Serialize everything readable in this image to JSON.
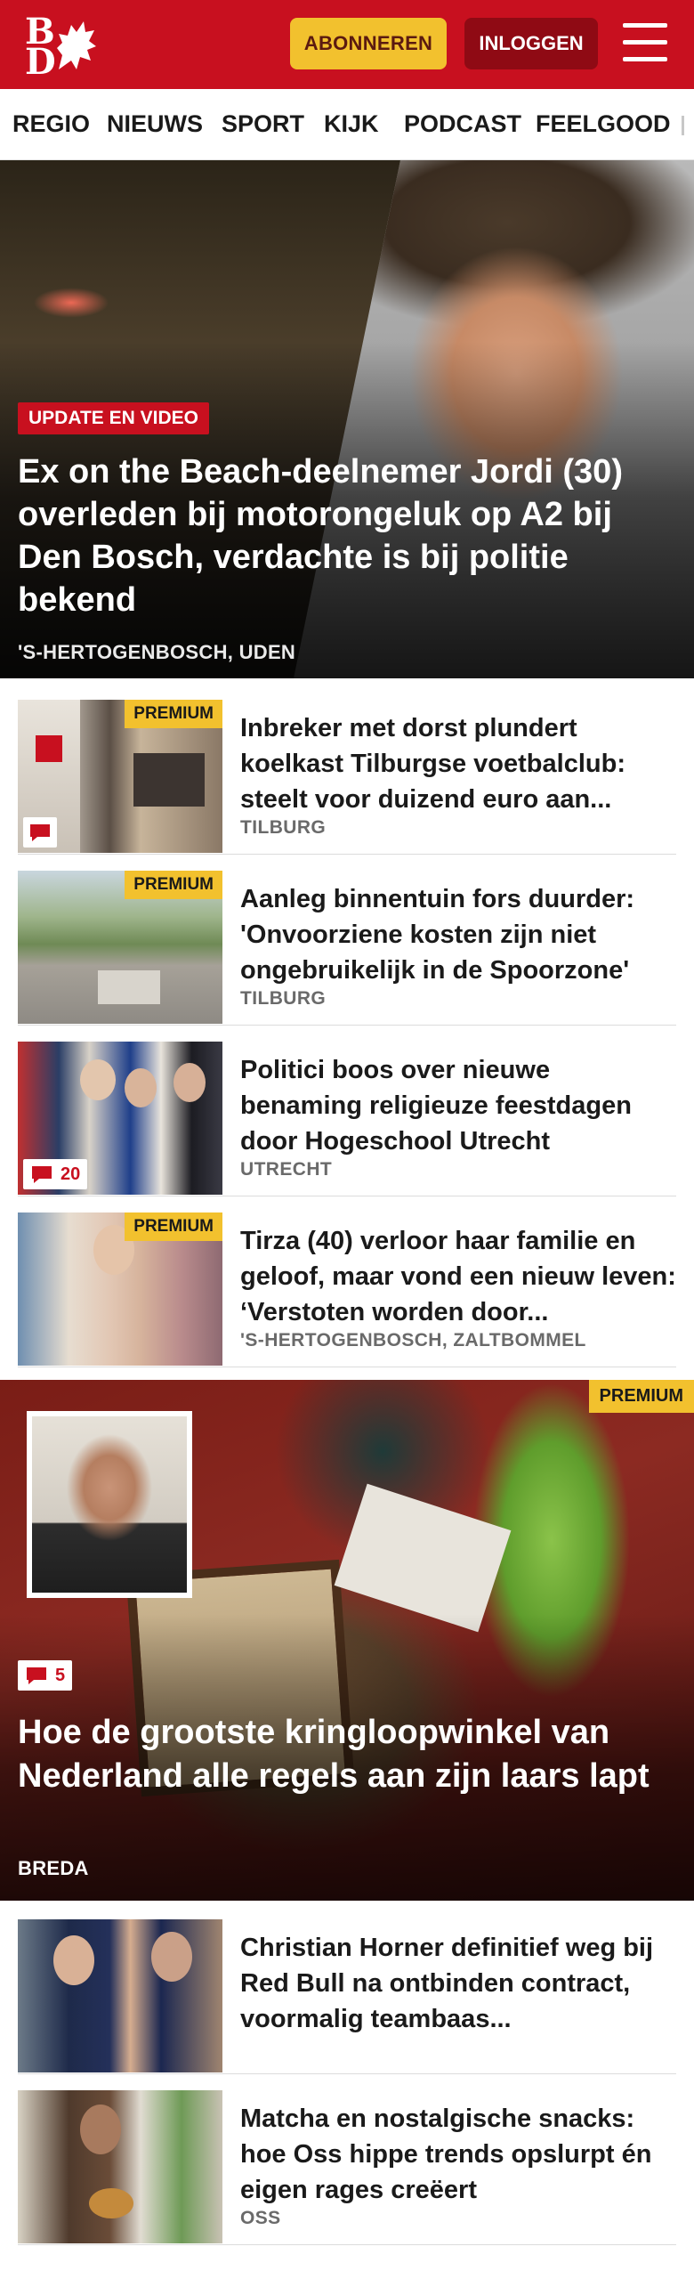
{
  "header": {
    "logo_letters": [
      "B",
      "D"
    ],
    "subscribe_label": "ABONNEREN",
    "login_label": "INLOGGEN",
    "brand_color": "#c8101f",
    "accent_color": "#f2c12e"
  },
  "nav": {
    "items": [
      "REGIO",
      "NIEUWS",
      "SPORT",
      "KIJK",
      "PODCAST",
      "FEELGOOD"
    ]
  },
  "hero": {
    "label": "UPDATE EN VIDEO",
    "title": "Ex on the Beach-deelnemer Jordi (30) overleden bij motorongeluk op A2 bij Den Bosch, verdachte is bij politie bekend",
    "location": "'S-HERTOGENBOSCH, UDEN"
  },
  "articles": [
    {
      "premium": "PREMIUM",
      "comments": "",
      "title": "Inbreker met dorst plundert koelkast Tilburgse voetbalclub: steelt voor duizend euro aan...",
      "location": "TILBURG"
    },
    {
      "premium": "PREMIUM",
      "comments": "",
      "title": "Aanleg binnentuin fors duurder: 'Onvoorziene kosten zijn niet ongebruikelijk in de Spoorzone'",
      "location": "TILBURG"
    },
    {
      "premium": "",
      "comments": "20",
      "title": "Politici boos over nieuwe benaming religieuze feestdagen door Hogeschool Utrecht",
      "location": "UTRECHT"
    },
    {
      "premium": "PREMIUM",
      "comments": "",
      "title": "Tirza (40) verloor haar familie en geloof, maar vond een nieuw leven: ‘Verstoten worden door...",
      "location": "'S-HERTOGENBOSCH, ZALTBOMMEL"
    }
  ],
  "feature": {
    "premium": "PREMIUM",
    "comments": "5",
    "title": "Hoe de grootste kringloopwinkel van Nederland alle regels aan zijn laars lapt",
    "location": "BREDA"
  },
  "articles_more": [
    {
      "title": "Christian Horner definitief weg bij Red Bull na ontbinden contract, voormalig teambaas...",
      "location": ""
    },
    {
      "title": "Matcha en nostalgische snacks: hoe Oss hippe trends opslurpt én eigen rages creëert",
      "location": "OSS"
    }
  ]
}
